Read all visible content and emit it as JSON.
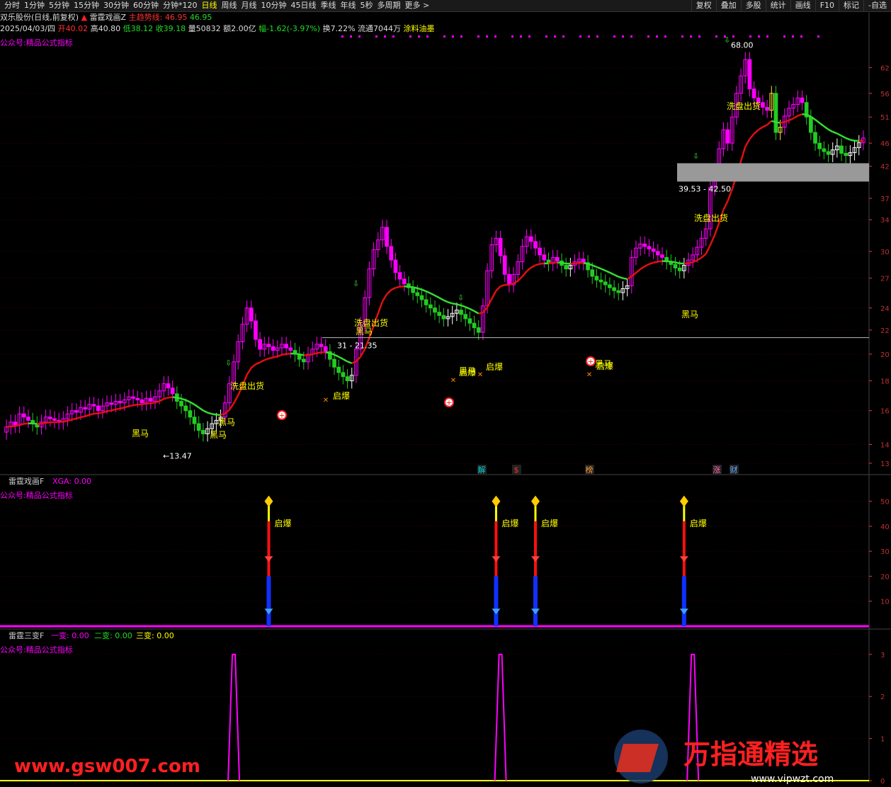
{
  "toolbar": {
    "periods": [
      "分时",
      "1分钟",
      "5分钟",
      "15分钟",
      "30分钟",
      "60分钟",
      "分钟*120",
      "日线",
      "周线",
      "月线",
      "10分钟",
      "45日线",
      "季线",
      "年线",
      "5秒",
      "多周期",
      "更多 >"
    ],
    "active": "日线",
    "right": [
      "复权",
      "叠加",
      "多股",
      "统计",
      "画线",
      "F10",
      "标记",
      "-自选"
    ]
  },
  "title": {
    "stock": "双乐股份(日线,前复权)",
    "indicator": "雷霆戏画Z",
    "trend_label": "主趋势线:",
    "trend_value1": "46.95",
    "trend_value2": "46.95"
  },
  "quote": {
    "date": "2025/04/03/四",
    "open": "开40.02",
    "high": "高40.80",
    "low": "低38.12",
    "close": "收39.18",
    "volume": "量50832",
    "amount": "额2.00亿",
    "change": "幅-1.62(-3.97%)",
    "turnover": "换7.22%",
    "float": "流通7044万",
    "sector": "涂料油墨"
  },
  "watermark_pane": "公众号:精品公式指标",
  "panel2": {
    "name": "雷霆戏画F",
    "field": "XGA: 0.00"
  },
  "panel3": {
    "name": "雷霆三变F",
    "f1": "一变: 0.00",
    "f2": "二变: 0.00",
    "f3": "三变: 0.00"
  },
  "footer": {
    "left": "www.gsw007.com",
    "right": "万指通精选",
    "right_sub": "www.vipwzt.com"
  },
  "colors": {
    "up": "#ff3030",
    "down": "#00e0e0",
    "magenta": "#ff00ff",
    "yellow": "#ffff00",
    "green": "#22dd22",
    "red_line": "#e01010",
    "axis": "#ff3030"
  },
  "chart_data": [
    {
      "type": "candlestick",
      "title": "雷霆戏画Z",
      "y_ticks": [
        13,
        14,
        16,
        18,
        20,
        22,
        24,
        27,
        30,
        34,
        37,
        42,
        46,
        51,
        56,
        62
      ],
      "annotations": {
        "low_label": "←13.47",
        "high_label": "68.00",
        "box_label": "39.53 - 42.50",
        "support_label": "31 - 21.35",
        "texts": [
          "黑马",
          "黑马",
          "黑马",
          "黑马",
          "黑马",
          "黑马",
          "黑马",
          "洗盘出货",
          "洗盘出货",
          "洗盘出货",
          "洗盘出货",
          "启爆",
          "启爆",
          "启爆",
          "启爆"
        ],
        "events": [
          "解",
          "$",
          "榜",
          "涨",
          "财"
        ]
      },
      "closes": [
        15.0,
        15.3,
        15.1,
        15.8,
        15.6,
        15.4,
        15.2,
        15.0,
        15.3,
        15.6,
        15.5,
        15.4,
        15.3,
        15.5,
        15.8,
        16.0,
        15.9,
        16.2,
        16.1,
        16.4,
        16.3,
        16.0,
        16.3,
        16.5,
        16.4,
        16.6,
        16.5,
        16.7,
        16.9,
        16.8,
        16.7,
        16.5,
        16.8,
        16.6,
        16.9,
        17.3,
        17.8,
        17.5,
        17.1,
        16.6,
        16.3,
        16.0,
        15.6,
        15.2,
        14.8,
        14.6,
        14.9,
        15.2,
        15.4,
        15.6,
        16.5,
        17.8,
        19.4,
        21.0,
        22.5,
        24.0,
        22.8,
        21.2,
        20.4,
        20.8,
        20.6,
        20.3,
        20.5,
        20.8,
        20.5,
        20.3,
        20.0,
        19.6,
        19.4,
        20.0,
        20.4,
        20.8,
        20.6,
        20.2,
        19.6,
        19.0,
        18.6,
        18.3,
        18.0,
        18.4,
        20.4,
        22.5,
        25.0,
        28.0,
        30.2,
        31.4,
        33.0,
        30.6,
        29.0,
        27.6,
        26.9,
        26.4,
        26.0,
        25.5,
        25.2,
        24.8,
        24.3,
        24.0,
        23.6,
        23.3,
        23.0,
        23.2,
        23.5,
        23.8,
        23.4,
        23.0,
        22.6,
        22.2,
        21.8,
        24.2,
        27.8,
        30.8,
        31.6,
        29.5,
        27.4,
        26.3,
        27.4,
        28.8,
        30.6,
        31.8,
        31.2,
        30.4,
        29.6,
        29.0,
        28.6,
        29.3,
        28.9,
        28.4,
        28.0,
        28.4,
        28.8,
        29.1,
        28.7,
        27.9,
        27.2,
        26.8,
        26.6,
        26.3,
        26.0,
        25.7,
        25.5,
        25.9,
        26.2,
        29.3,
        30.4,
        30.9,
        30.6,
        30.3,
        30.0,
        29.6,
        29.3,
        28.8,
        28.5,
        28.1,
        27.8,
        28.4,
        29.0,
        29.6,
        30.5,
        31.6,
        32.8,
        38.6,
        41.0,
        45.0,
        48.5,
        46.0,
        51.0,
        56.0,
        60.0,
        64.0,
        57.0,
        55.0,
        54.0,
        53.0,
        52.4,
        56.0,
        48.0,
        49.0,
        51.2,
        52.8,
        53.6,
        55.0,
        54.0,
        51.0,
        48.0,
        46.0,
        45.0,
        44.5,
        44.0,
        44.8,
        45.5,
        44.2,
        43.8,
        44.3,
        45.2,
        46.1,
        46.95
      ],
      "trend_line_range": [
        15.0,
        53.8
      ],
      "series": [
        {
          "name": "主趋势线",
          "values_last": 46.95
        }
      ]
    },
    {
      "type": "bar",
      "title": "雷霆戏画F",
      "y_ticks": [
        10,
        20,
        30,
        40,
        50
      ],
      "spikes": [
        {
          "day": 60,
          "value": 50
        },
        {
          "day": 112,
          "value": 50
        },
        {
          "day": 121,
          "value": 50
        },
        {
          "day": 155,
          "value": 50
        }
      ],
      "labels": [
        "启爆",
        "启爆",
        "启爆",
        "启爆"
      ]
    },
    {
      "type": "line",
      "title": "雷霆三变F",
      "y_ticks": [
        0,
        1,
        2,
        3
      ],
      "spikes": [
        {
          "day": 52,
          "value": 3
        },
        {
          "day": 113,
          "value": 3
        },
        {
          "day": 157,
          "value": 3
        }
      ]
    }
  ]
}
